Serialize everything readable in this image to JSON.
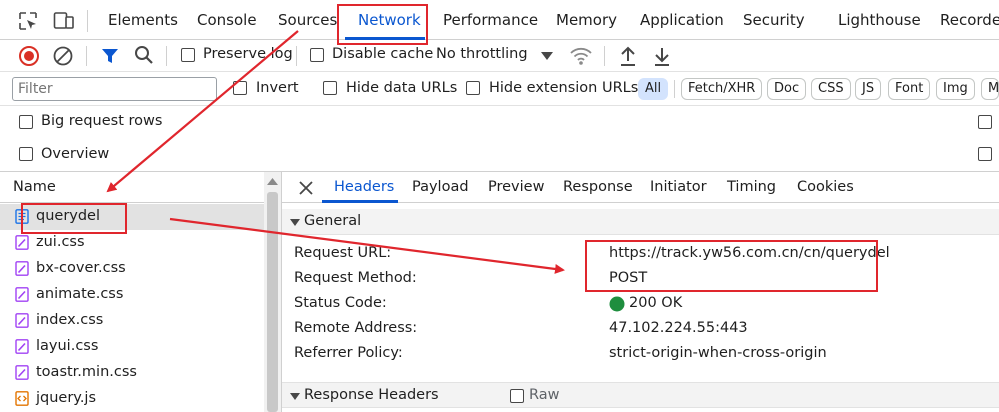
{
  "devtools": {
    "tabs": [
      "Elements",
      "Console",
      "Sources",
      "Network",
      "Performance",
      "Memory",
      "Application",
      "Security",
      "Lighthouse",
      "Recorder"
    ],
    "active_tab": "Network"
  },
  "toolbar": {
    "preserve_log": "Preserve log",
    "disable_cache": "Disable cache",
    "throttling": "No throttling"
  },
  "filterbar": {
    "filter_placeholder": "Filter",
    "invert": "Invert",
    "hide_data_urls": "Hide data URLs",
    "hide_extension_urls": "Hide extension URLs",
    "chips": [
      "All",
      "Fetch/XHR",
      "Doc",
      "CSS",
      "JS",
      "Font",
      "Img",
      "M"
    ]
  },
  "options": {
    "big_request_rows": "Big request rows",
    "overview": "Overview"
  },
  "request_list": {
    "header": "Name",
    "items": [
      {
        "name": "querydel",
        "type": "doc"
      },
      {
        "name": "zui.css",
        "type": "css"
      },
      {
        "name": "bx-cover.css",
        "type": "css"
      },
      {
        "name": "animate.css",
        "type": "css"
      },
      {
        "name": "index.css",
        "type": "css"
      },
      {
        "name": "layui.css",
        "type": "css"
      },
      {
        "name": "toastr.min.css",
        "type": "css"
      },
      {
        "name": "jquery.js",
        "type": "js"
      }
    ]
  },
  "details": {
    "tabs": [
      "Headers",
      "Payload",
      "Preview",
      "Response",
      "Initiator",
      "Timing",
      "Cookies"
    ],
    "active_tab": "Headers",
    "general_title": "General",
    "general": [
      {
        "key": "Request URL:",
        "value": "https://track.yw56.com.cn/cn/querydel"
      },
      {
        "key": "Request Method:",
        "value": "POST"
      },
      {
        "key": "Status Code:",
        "value": "200 OK"
      },
      {
        "key": "Remote Address:",
        "value": "47.102.224.55:443"
      },
      {
        "key": "Referrer Policy:",
        "value": "strict-origin-when-cross-origin"
      }
    ],
    "response_headers_title": "Response Headers",
    "raw_label": "Raw"
  },
  "colors": {
    "accent": "#0b57d0",
    "annotation_red": "#e0262d",
    "status_ok": "#1e8e3e",
    "record_red": "#d93025"
  }
}
